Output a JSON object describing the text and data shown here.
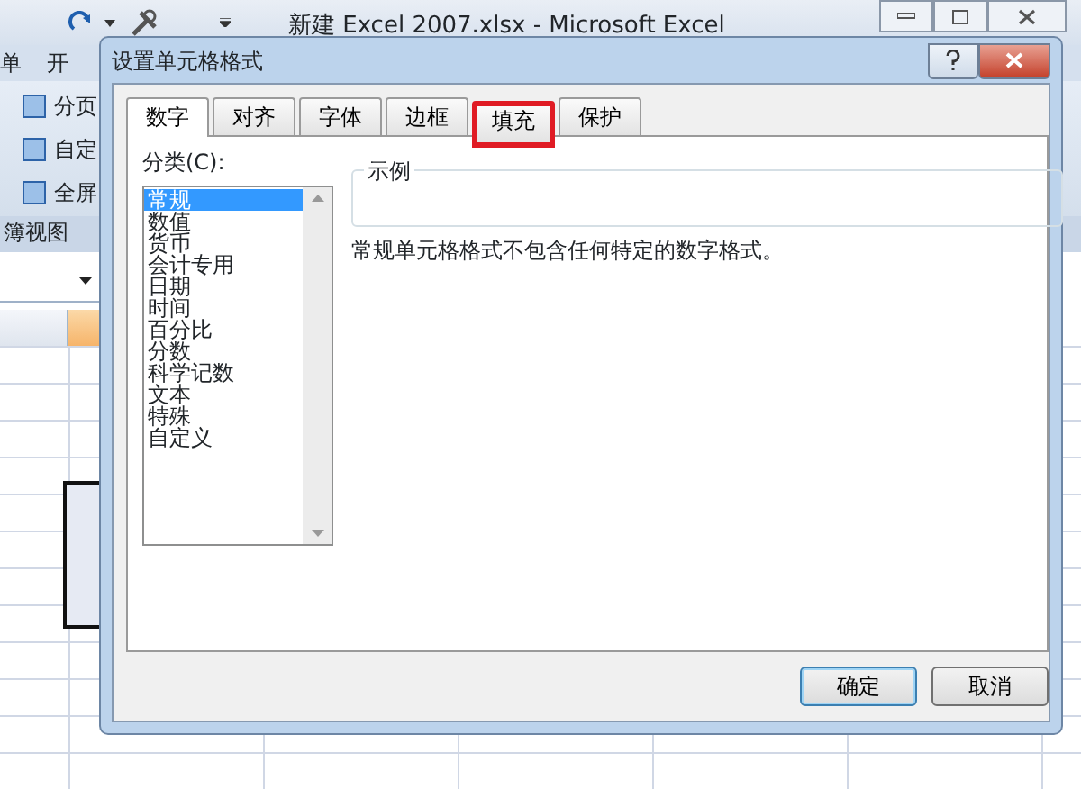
{
  "excel": {
    "title": "新建 Excel 2007.xlsx - Microsoft Excel",
    "ribbon_tabs": [
      "单",
      "开"
    ],
    "ribbon_buttons": [
      "分页",
      "自定",
      "全屏"
    ],
    "group_label": "簿视图"
  },
  "dialog": {
    "title": "设置单元格格式",
    "tabs": [
      {
        "label": "数字",
        "selected": true,
        "highlighted": false
      },
      {
        "label": "对齐",
        "selected": false,
        "highlighted": false
      },
      {
        "label": "字体",
        "selected": false,
        "highlighted": false
      },
      {
        "label": "边框",
        "selected": false,
        "highlighted": false
      },
      {
        "label": "填充",
        "selected": false,
        "highlighted": true
      },
      {
        "label": "保护",
        "selected": false,
        "highlighted": false
      }
    ],
    "category_label": "分类(C):",
    "categories": [
      {
        "label": "常规",
        "selected": true
      },
      {
        "label": "数值",
        "selected": false
      },
      {
        "label": "货币",
        "selected": false
      },
      {
        "label": "会计专用",
        "selected": false
      },
      {
        "label": "日期",
        "selected": false
      },
      {
        "label": "时间",
        "selected": false
      },
      {
        "label": "百分比",
        "selected": false
      },
      {
        "label": "分数",
        "selected": false
      },
      {
        "label": "科学记数",
        "selected": false
      },
      {
        "label": "文本",
        "selected": false
      },
      {
        "label": "特殊",
        "selected": false
      },
      {
        "label": "自定义",
        "selected": false
      }
    ],
    "sample_label": "示例",
    "description": "常规单元格格式不包含任何特定的数字格式。",
    "buttons": [
      "确定",
      "取消"
    ]
  }
}
